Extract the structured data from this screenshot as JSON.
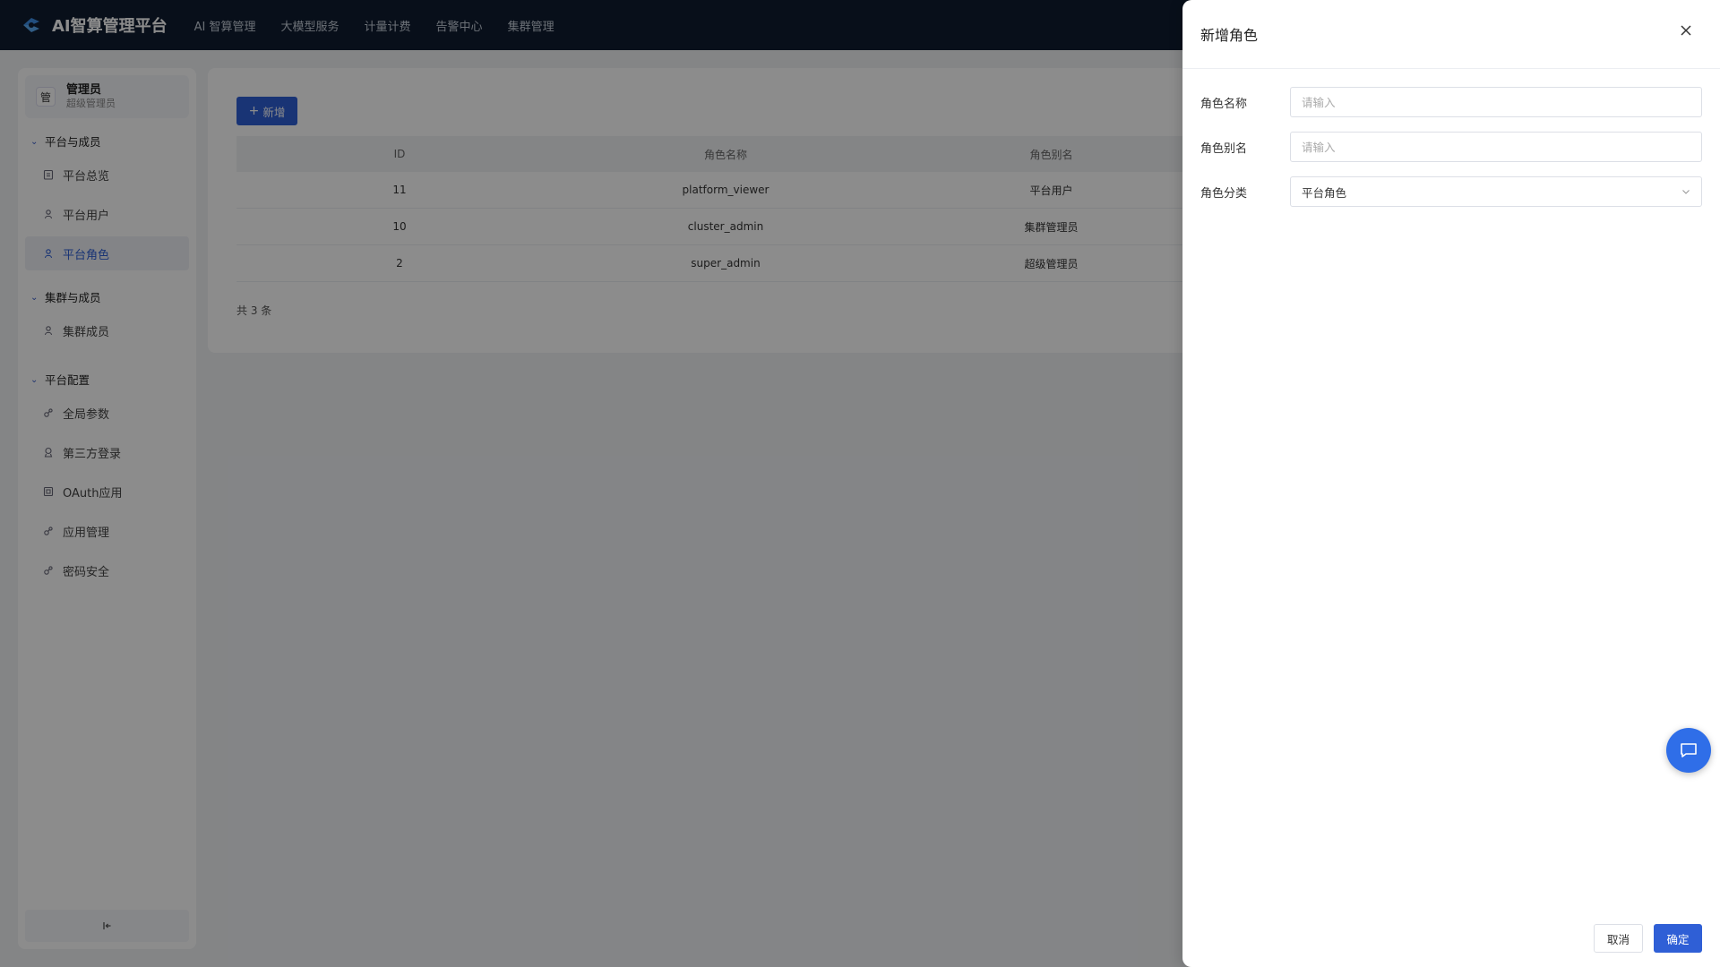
{
  "app": {
    "title": "AI智算管理平台"
  },
  "nav": [
    "AI 智算管理",
    "大模型服务",
    "计量计费",
    "告警中心",
    "集群管理"
  ],
  "user": {
    "avatar": "管",
    "name": "管理员",
    "role": "超级管理员"
  },
  "sidebar": {
    "groups": [
      {
        "label": "平台与成员",
        "items": [
          {
            "label": "平台总览",
            "icon": "clipboard-icon"
          },
          {
            "label": "平台用户",
            "icon": "user-icon"
          },
          {
            "label": "平台角色",
            "icon": "role-icon",
            "active": true
          }
        ]
      },
      {
        "label": "集群与成员",
        "items": [
          {
            "label": "集群成员",
            "icon": "user-icon"
          }
        ]
      },
      {
        "label": "平台配置",
        "items": [
          {
            "label": "全局参数",
            "icon": "link-icon"
          },
          {
            "label": "第三方登录",
            "icon": "badge-icon"
          },
          {
            "label": "OAuth应用",
            "icon": "app-icon"
          },
          {
            "label": "应用管理",
            "icon": "link-icon"
          },
          {
            "label": "密码安全",
            "icon": "link-icon"
          }
        ]
      }
    ],
    "collapse_icon": "collapse-left-icon"
  },
  "main": {
    "add_label": "新增",
    "table": {
      "columns": [
        "ID",
        "角色名称",
        "角色别名"
      ],
      "rows": [
        [
          "11",
          "platform_viewer",
          "平台用户"
        ],
        [
          "10",
          "cluster_admin",
          "集群管理员"
        ],
        [
          "2",
          "super_admin",
          "超级管理员"
        ]
      ]
    },
    "total": "共 3 条"
  },
  "drawer": {
    "title": "新增角色",
    "fields": {
      "name": {
        "label": "角色名称",
        "placeholder": "请输入",
        "value": ""
      },
      "alias": {
        "label": "角色别名",
        "placeholder": "请输入",
        "value": ""
      },
      "category": {
        "label": "角色分类",
        "value": "平台角色"
      }
    },
    "cancel": "取消",
    "ok": "确定"
  },
  "colors": {
    "primary": "#2f5fd6",
    "topbar": "#101c30"
  }
}
